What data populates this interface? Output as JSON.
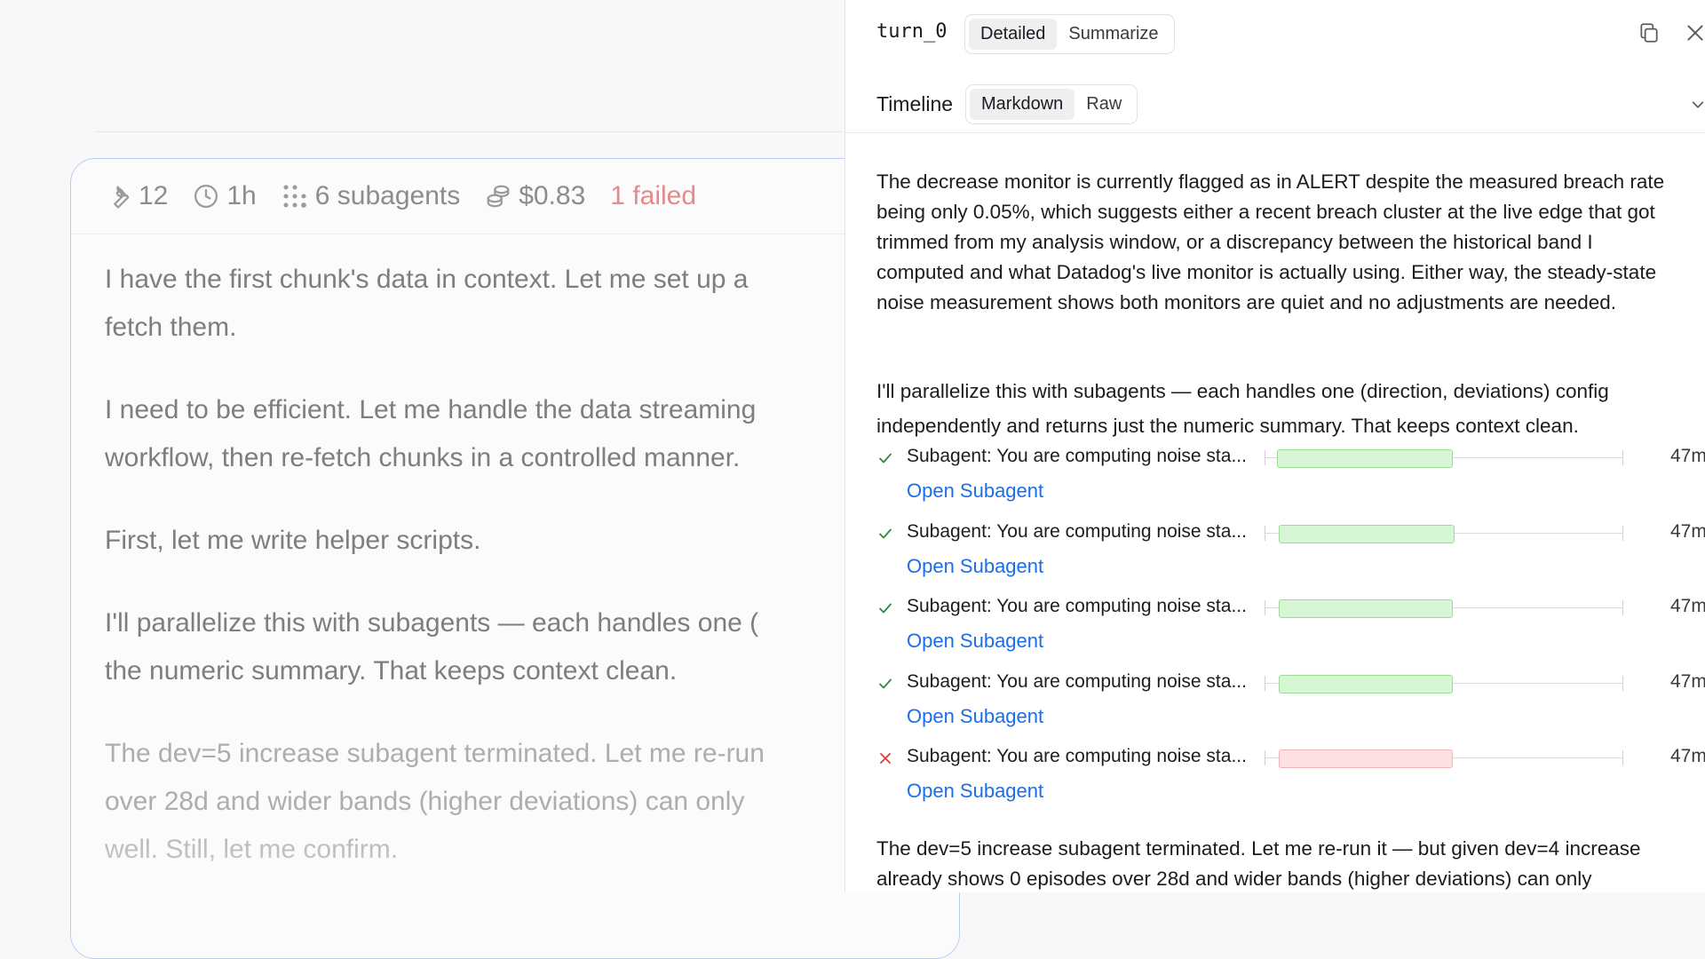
{
  "card": {
    "stats": {
      "tool_calls": "12",
      "duration": "1h",
      "subagents": "6 subagents",
      "cost": "$0.83",
      "failed": "1 failed"
    },
    "paragraphs": [
      {
        "lines": [
          "I have the first chunk's data in context. Let me set up a",
          "fetch them."
        ]
      },
      {
        "lines": [
          "I need to be efficient. Let me handle the data streaming",
          "workflow, then re-fetch chunks in a controlled manner."
        ]
      },
      {
        "lines": [
          "First, let me write helper scripts."
        ]
      },
      {
        "lines": [
          "I'll parallelize this with subagents — each handles one (",
          "the numeric summary. That keeps context clean."
        ]
      },
      {
        "lines": [
          "The dev=5 increase subagent terminated. Let me re-run",
          "over 28d and wider bands (higher deviations) can only",
          "well. Still, let me confirm."
        ]
      }
    ]
  },
  "panel": {
    "turn_id": "turn_0",
    "view_modes": [
      "Detailed",
      "Summarize"
    ],
    "active_view": "Detailed",
    "section_title": "Timeline",
    "format_modes": [
      "Markdown",
      "Raw"
    ],
    "active_format": "Markdown",
    "icons": {
      "copy": "copy-icon",
      "close": "close-icon",
      "expand": "chevron-down-icon"
    },
    "paragraph_1": "The decrease monitor is currently flagged as in ALERT despite the measured breach rate being only 0.05%, which suggests either a recent breach cluster at the live edge that got trimmed from my analysis window, or a discrepancy between the historical band I computed and what Datadog's live monitor is actually using. Either way, the steady-state noise measurement shows both monitors are quiet and no adjustments are needed.",
    "paragraph_2": "I'll parallelize this with subagents — each handles one (direction, deviations) config independently and returns just the numeric summary. That keeps context clean.",
    "subagents": [
      {
        "label": "Subagent: You are computing noise sta...",
        "status": "success",
        "duration": "47m",
        "link": "Open Subagent",
        "bar_start": 0.035,
        "bar_end": 0.52
      },
      {
        "label": "Subagent: You are computing noise sta...",
        "status": "success",
        "duration": "47m",
        "link": "Open Subagent",
        "bar_start": 0.04,
        "bar_end": 0.525
      },
      {
        "label": "Subagent: You are computing noise sta...",
        "status": "success",
        "duration": "47m",
        "link": "Open Subagent",
        "bar_start": 0.04,
        "bar_end": 0.522
      },
      {
        "label": "Subagent: You are computing noise sta...",
        "status": "success",
        "duration": "47m",
        "link": "Open Subagent",
        "bar_start": 0.04,
        "bar_end": 0.52
      },
      {
        "label": "Subagent: You are computing noise sta...",
        "status": "failed",
        "duration": "47m",
        "link": "Open Subagent",
        "bar_start": 0.04,
        "bar_end": 0.52
      }
    ],
    "paragraph_3": "The dev=5 increase subagent terminated. Let me re-run it — but given dev=4 increase already shows 0 episodes over 28d and wider bands (higher deviations) can only"
  },
  "colors": {
    "accent": "#1a6fe8",
    "failed": "#e58a8a",
    "success_fill": "#d7f6d5",
    "fail_fill": "#fde0e2"
  }
}
